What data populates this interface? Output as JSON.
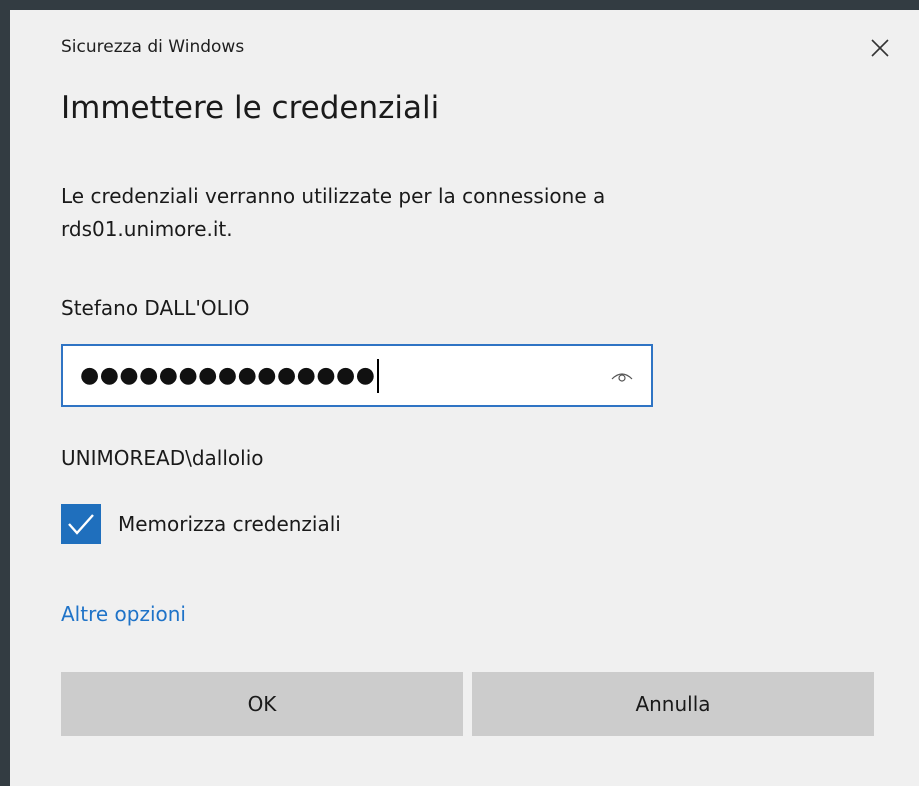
{
  "window": {
    "title": "Sicurezza di Windows"
  },
  "dialog": {
    "heading": "Immettere le credenziali",
    "description": "Le credenziali verranno utilizzate per la connessione a rds01.unimore.it.",
    "username": "Stefano DALL'OLIO",
    "password_masked": "●●●●●●●●●●●●●●●",
    "domain_user": "UNIMOREAD\\dallolio",
    "remember_label": "Memorizza credenziali",
    "remember_checked": true,
    "more_options_label": "Altre opzioni",
    "ok_label": "OK",
    "cancel_label": "Annulla"
  },
  "icons": {
    "close": "close-icon",
    "reveal": "eye-icon",
    "check": "checkmark-icon"
  },
  "colors": {
    "accent": "#1f6fbd",
    "link": "#1f73c8",
    "field_border": "#2f74c4",
    "button_bg": "#cccccc",
    "dialog_bg": "#f0f0f0"
  }
}
